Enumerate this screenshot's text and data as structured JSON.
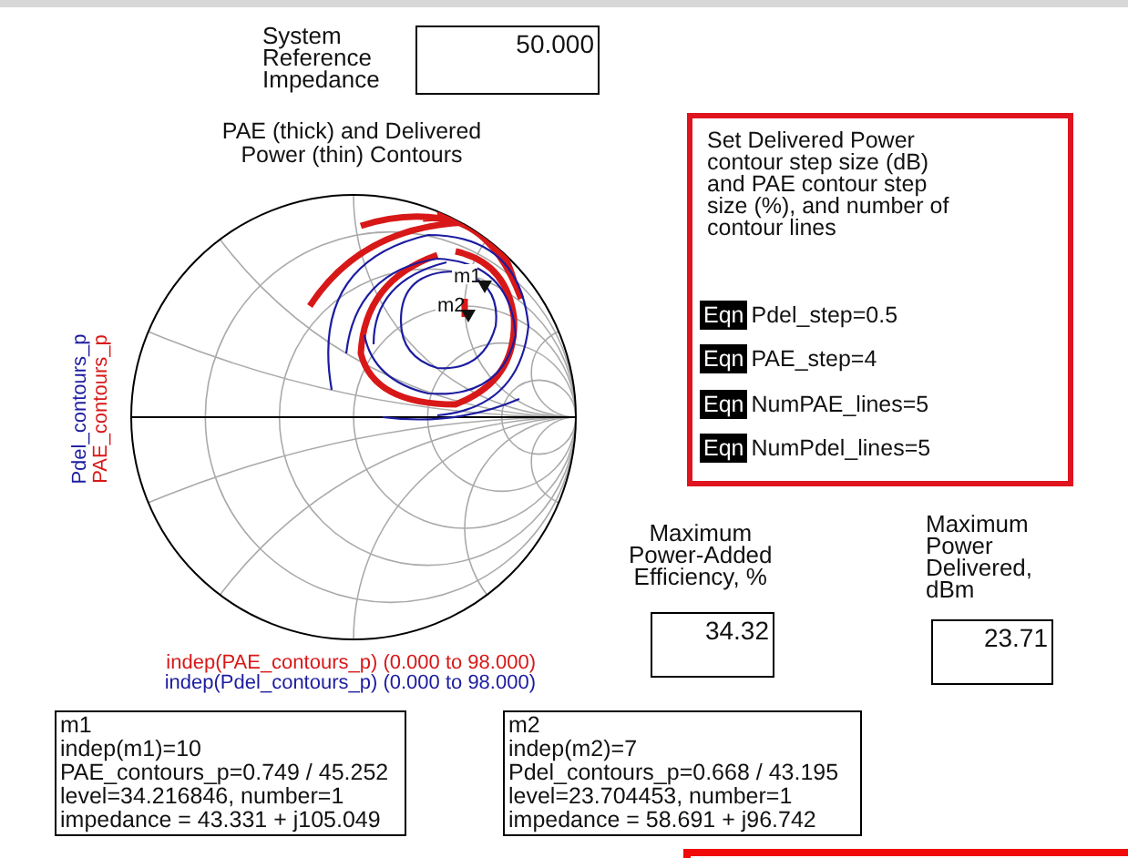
{
  "reference_impedance": {
    "label": "System\nReference\nImpedance",
    "value": "50.000"
  },
  "smith_chart": {
    "title": "PAE (thick) and Delivered\nPower (thin) Contours",
    "traces": [
      {
        "name": "PAE_contours_p",
        "kind": "thick",
        "color": "#d81818",
        "sweep": "indep(PAE_contours_p) (0.000 to 98.000)"
      },
      {
        "name": "Pdel_contours_p",
        "kind": "thin",
        "color": "#1c1ca0",
        "sweep": "indep(Pdel_contours_p) (0.000 to 98.000)"
      }
    ],
    "markers": [
      {
        "label": "m1"
      },
      {
        "label": "m2"
      }
    ]
  },
  "equation_panel": {
    "note": "Set Delivered Power\ncontour step size (dB)\nand PAE contour step\nsize (%), and number of\ncontour lines",
    "equations": [
      {
        "badge": "Eqn",
        "text": "Pdel_step=0.5"
      },
      {
        "badge": "Eqn",
        "text": "PAE_step=4"
      },
      {
        "badge": "Eqn",
        "text": "NumPAE_lines=5"
      },
      {
        "badge": "Eqn",
        "text": "NumPdel_lines=5"
      }
    ]
  },
  "readouts": [
    {
      "label": "Maximum\nPower-Added\nEfficiency, %",
      "value": "34.32"
    },
    {
      "label": "Maximum\nPower\nDelivered,\ndBm",
      "value": "23.71"
    }
  ],
  "marker_readouts": [
    {
      "lines": [
        "m1",
        "indep(m1)=10",
        "PAE_contours_p=0.749 / 45.252",
        "level=34.216846, number=1",
        "impedance = 43.331 + j105.049"
      ]
    },
    {
      "lines": [
        "m2",
        "indep(m2)=7",
        "Pdel_contours_p=0.668 / 43.195",
        "level=23.704453, number=1",
        "impedance = 58.691 + j96.742"
      ]
    }
  ]
}
